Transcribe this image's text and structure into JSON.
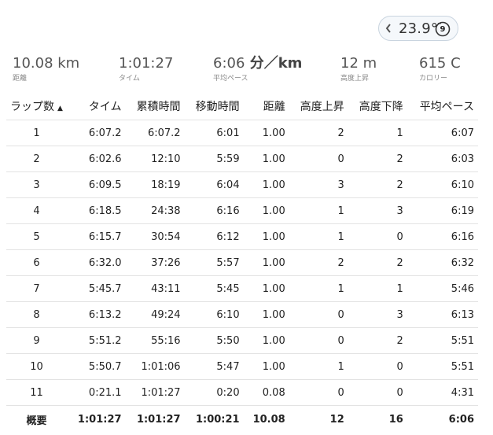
{
  "weather": {
    "temperature": "23.9°",
    "icon_number": "9"
  },
  "stats": [
    {
      "value": "10.08",
      "unit": " km",
      "label": "距離"
    },
    {
      "value": "1:01:27",
      "unit": "",
      "label": "タイム"
    },
    {
      "value": "6:06",
      "unit": " 分／km",
      "label": "平均ペース"
    },
    {
      "value": "12",
      "unit": " m",
      "label": "高度上昇"
    },
    {
      "value": "615",
      "unit": " C",
      "label": "カロリー"
    }
  ],
  "table": {
    "headers": [
      "ラップ数",
      "タイム",
      "累積時間",
      "移動時間",
      "距離",
      "高度上昇",
      "高度下降",
      "平均ペース"
    ],
    "sort_indicator": "▲",
    "rows": [
      [
        "1",
        "6:07.2",
        "6:07.2",
        "6:01",
        "1.00",
        "2",
        "1",
        "6:07"
      ],
      [
        "2",
        "6:02.6",
        "12:10",
        "5:59",
        "1.00",
        "0",
        "2",
        "6:03"
      ],
      [
        "3",
        "6:09.5",
        "18:19",
        "6:04",
        "1.00",
        "3",
        "2",
        "6:10"
      ],
      [
        "4",
        "6:18.5",
        "24:38",
        "6:16",
        "1.00",
        "1",
        "3",
        "6:19"
      ],
      [
        "5",
        "6:15.7",
        "30:54",
        "6:12",
        "1.00",
        "1",
        "0",
        "6:16"
      ],
      [
        "6",
        "6:32.0",
        "37:26",
        "5:57",
        "1.00",
        "2",
        "2",
        "6:32"
      ],
      [
        "7",
        "5:45.7",
        "43:11",
        "5:45",
        "1.00",
        "1",
        "1",
        "5:46"
      ],
      [
        "8",
        "6:13.2",
        "49:24",
        "6:10",
        "1.00",
        "0",
        "3",
        "6:13"
      ],
      [
        "9",
        "5:51.2",
        "55:16",
        "5:50",
        "1.00",
        "0",
        "2",
        "5:51"
      ],
      [
        "10",
        "5:50.7",
        "1:01:06",
        "5:47",
        "1.00",
        "1",
        "0",
        "5:51"
      ],
      [
        "11",
        "0:21.1",
        "1:01:27",
        "0:20",
        "0.08",
        "0",
        "0",
        "4:31"
      ]
    ],
    "summary": [
      "概要",
      "1:01:27",
      "1:01:27",
      "1:00:21",
      "10.08",
      "12",
      "16",
      "6:06"
    ]
  },
  "colors": {
    "border": "#e3e3e3",
    "pill_border": "#c9d4df",
    "label": "#888888"
  }
}
